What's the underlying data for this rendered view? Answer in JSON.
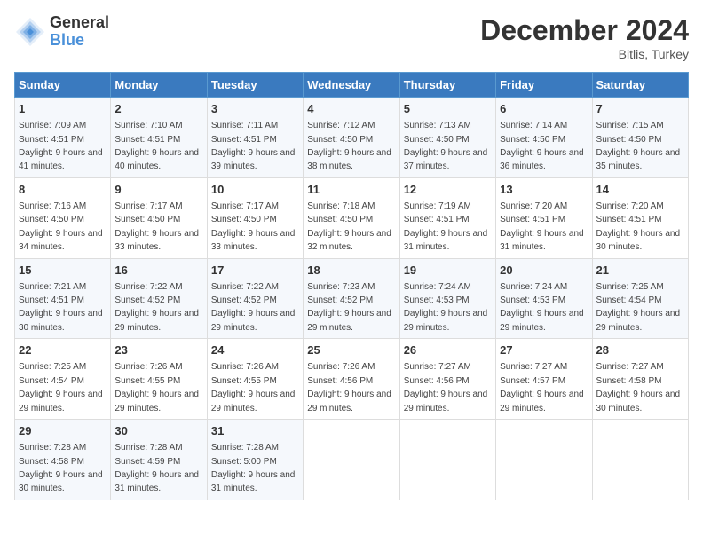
{
  "logo": {
    "general": "General",
    "blue": "Blue"
  },
  "title": "December 2024",
  "location": "Bitlis, Turkey",
  "days_of_week": [
    "Sunday",
    "Monday",
    "Tuesday",
    "Wednesday",
    "Thursday",
    "Friday",
    "Saturday"
  ],
  "weeks": [
    [
      {
        "day": "1",
        "sunrise": "7:09 AM",
        "sunset": "4:51 PM",
        "daylight": "9 hours and 41 minutes."
      },
      {
        "day": "2",
        "sunrise": "7:10 AM",
        "sunset": "4:51 PM",
        "daylight": "9 hours and 40 minutes."
      },
      {
        "day": "3",
        "sunrise": "7:11 AM",
        "sunset": "4:51 PM",
        "daylight": "9 hours and 39 minutes."
      },
      {
        "day": "4",
        "sunrise": "7:12 AM",
        "sunset": "4:50 PM",
        "daylight": "9 hours and 38 minutes."
      },
      {
        "day": "5",
        "sunrise": "7:13 AM",
        "sunset": "4:50 PM",
        "daylight": "9 hours and 37 minutes."
      },
      {
        "day": "6",
        "sunrise": "7:14 AM",
        "sunset": "4:50 PM",
        "daylight": "9 hours and 36 minutes."
      },
      {
        "day": "7",
        "sunrise": "7:15 AM",
        "sunset": "4:50 PM",
        "daylight": "9 hours and 35 minutes."
      }
    ],
    [
      {
        "day": "8",
        "sunrise": "7:16 AM",
        "sunset": "4:50 PM",
        "daylight": "9 hours and 34 minutes."
      },
      {
        "day": "9",
        "sunrise": "7:17 AM",
        "sunset": "4:50 PM",
        "daylight": "9 hours and 33 minutes."
      },
      {
        "day": "10",
        "sunrise": "7:17 AM",
        "sunset": "4:50 PM",
        "daylight": "9 hours and 33 minutes."
      },
      {
        "day": "11",
        "sunrise": "7:18 AM",
        "sunset": "4:50 PM",
        "daylight": "9 hours and 32 minutes."
      },
      {
        "day": "12",
        "sunrise": "7:19 AM",
        "sunset": "4:51 PM",
        "daylight": "9 hours and 31 minutes."
      },
      {
        "day": "13",
        "sunrise": "7:20 AM",
        "sunset": "4:51 PM",
        "daylight": "9 hours and 31 minutes."
      },
      {
        "day": "14",
        "sunrise": "7:20 AM",
        "sunset": "4:51 PM",
        "daylight": "9 hours and 30 minutes."
      }
    ],
    [
      {
        "day": "15",
        "sunrise": "7:21 AM",
        "sunset": "4:51 PM",
        "daylight": "9 hours and 30 minutes."
      },
      {
        "day": "16",
        "sunrise": "7:22 AM",
        "sunset": "4:52 PM",
        "daylight": "9 hours and 29 minutes."
      },
      {
        "day": "17",
        "sunrise": "7:22 AM",
        "sunset": "4:52 PM",
        "daylight": "9 hours and 29 minutes."
      },
      {
        "day": "18",
        "sunrise": "7:23 AM",
        "sunset": "4:52 PM",
        "daylight": "9 hours and 29 minutes."
      },
      {
        "day": "19",
        "sunrise": "7:24 AM",
        "sunset": "4:53 PM",
        "daylight": "9 hours and 29 minutes."
      },
      {
        "day": "20",
        "sunrise": "7:24 AM",
        "sunset": "4:53 PM",
        "daylight": "9 hours and 29 minutes."
      },
      {
        "day": "21",
        "sunrise": "7:25 AM",
        "sunset": "4:54 PM",
        "daylight": "9 hours and 29 minutes."
      }
    ],
    [
      {
        "day": "22",
        "sunrise": "7:25 AM",
        "sunset": "4:54 PM",
        "daylight": "9 hours and 29 minutes."
      },
      {
        "day": "23",
        "sunrise": "7:26 AM",
        "sunset": "4:55 PM",
        "daylight": "9 hours and 29 minutes."
      },
      {
        "day": "24",
        "sunrise": "7:26 AM",
        "sunset": "4:55 PM",
        "daylight": "9 hours and 29 minutes."
      },
      {
        "day": "25",
        "sunrise": "7:26 AM",
        "sunset": "4:56 PM",
        "daylight": "9 hours and 29 minutes."
      },
      {
        "day": "26",
        "sunrise": "7:27 AM",
        "sunset": "4:56 PM",
        "daylight": "9 hours and 29 minutes."
      },
      {
        "day": "27",
        "sunrise": "7:27 AM",
        "sunset": "4:57 PM",
        "daylight": "9 hours and 29 minutes."
      },
      {
        "day": "28",
        "sunrise": "7:27 AM",
        "sunset": "4:58 PM",
        "daylight": "9 hours and 30 minutes."
      }
    ],
    [
      {
        "day": "29",
        "sunrise": "7:28 AM",
        "sunset": "4:58 PM",
        "daylight": "9 hours and 30 minutes."
      },
      {
        "day": "30",
        "sunrise": "7:28 AM",
        "sunset": "4:59 PM",
        "daylight": "9 hours and 31 minutes."
      },
      {
        "day": "31",
        "sunrise": "7:28 AM",
        "sunset": "5:00 PM",
        "daylight": "9 hours and 31 minutes."
      },
      null,
      null,
      null,
      null
    ]
  ]
}
